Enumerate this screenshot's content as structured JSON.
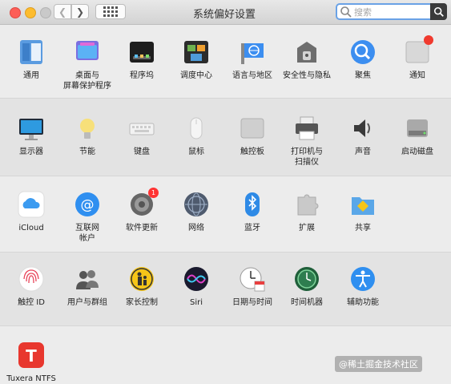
{
  "window": {
    "title": "系统偏好设置",
    "search_placeholder": "搜索",
    "back_glyph": "❮",
    "forward_glyph": "❯"
  },
  "rows": [
    [
      {
        "label": "通用",
        "icon": "general-icon"
      },
      {
        "label": "桌面与\n屏幕保护程序",
        "icon": "desktop-screensaver-icon"
      },
      {
        "label": "程序坞",
        "icon": "dock-icon"
      },
      {
        "label": "调度中心",
        "icon": "mission-control-icon"
      },
      {
        "label": "语言与地区",
        "icon": "language-region-icon"
      },
      {
        "label": "安全性与隐私",
        "icon": "security-privacy-icon"
      },
      {
        "label": "聚焦",
        "icon": "spotlight-icon"
      },
      {
        "label": "通知",
        "icon": "notifications-icon"
      }
    ],
    [
      {
        "label": "显示器",
        "icon": "displays-icon"
      },
      {
        "label": "节能",
        "icon": "energy-saver-icon"
      },
      {
        "label": "键盘",
        "icon": "keyboard-icon"
      },
      {
        "label": "鼠标",
        "icon": "mouse-icon"
      },
      {
        "label": "触控板",
        "icon": "trackpad-icon"
      },
      {
        "label": "打印机与\n扫描仪",
        "icon": "printers-scanners-icon"
      },
      {
        "label": "声音",
        "icon": "sound-icon"
      },
      {
        "label": "启动磁盘",
        "icon": "startup-disk-icon"
      }
    ],
    [
      {
        "label": "iCloud",
        "icon": "icloud-icon"
      },
      {
        "label": "互联网\n帐户",
        "icon": "internet-accounts-icon"
      },
      {
        "label": "软件更新",
        "icon": "software-update-icon",
        "badge": "1"
      },
      {
        "label": "网络",
        "icon": "network-icon"
      },
      {
        "label": "蓝牙",
        "icon": "bluetooth-icon"
      },
      {
        "label": "扩展",
        "icon": "extensions-icon"
      },
      {
        "label": "共享",
        "icon": "sharing-icon"
      }
    ],
    [
      {
        "label": "触控 ID",
        "icon": "touch-id-icon"
      },
      {
        "label": "用户与群组",
        "icon": "users-groups-icon"
      },
      {
        "label": "家长控制",
        "icon": "parental-controls-icon"
      },
      {
        "label": "Siri",
        "icon": "siri-icon"
      },
      {
        "label": "日期与时间",
        "icon": "date-time-icon"
      },
      {
        "label": "时间机器",
        "icon": "time-machine-icon"
      },
      {
        "label": "辅助功能",
        "icon": "accessibility-icon"
      }
    ],
    [
      {
        "label": "Tuxera NTFS",
        "icon": "tuxera-ntfs-icon"
      }
    ]
  ],
  "watermark": "@稀土掘金技术社区",
  "colors": {
    "accent": "#3c8ef0",
    "badge": "#ff3b30"
  }
}
